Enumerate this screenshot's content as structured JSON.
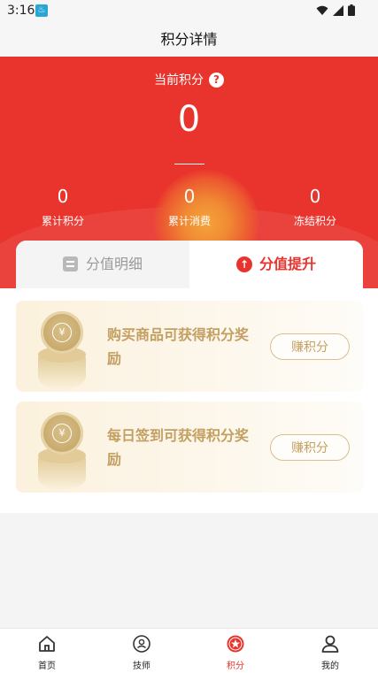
{
  "status_bar": {
    "time": "3:16"
  },
  "nav": {
    "title": "积分详情"
  },
  "hero": {
    "label": "当前积分",
    "help_symbol": "?",
    "current_points": "0",
    "stats": [
      {
        "value": "0",
        "label": "累计积分"
      },
      {
        "value": "0",
        "label": "累计消费"
      },
      {
        "value": "0",
        "label": "冻结积分"
      }
    ]
  },
  "tabs": {
    "detail": "分值明细",
    "boost": "分值提升",
    "active": "boost"
  },
  "cards": [
    {
      "text": "购买商品可获得积分奖励",
      "button": "赚积分",
      "coin_symbol": "¥"
    },
    {
      "text": "每日签到可获得积分奖励",
      "button": "赚积分",
      "coin_symbol": "¥"
    }
  ],
  "bottom_nav": [
    {
      "label": "首页",
      "icon": "home-icon"
    },
    {
      "label": "技师",
      "icon": "technician-icon"
    },
    {
      "label": "积分",
      "icon": "points-star-icon",
      "active": true
    },
    {
      "label": "我的",
      "icon": "profile-icon"
    }
  ],
  "colors": {
    "primary_red": "#e9342d",
    "gold_text": "#c3a062",
    "card_bg": "#fbf1dd"
  }
}
